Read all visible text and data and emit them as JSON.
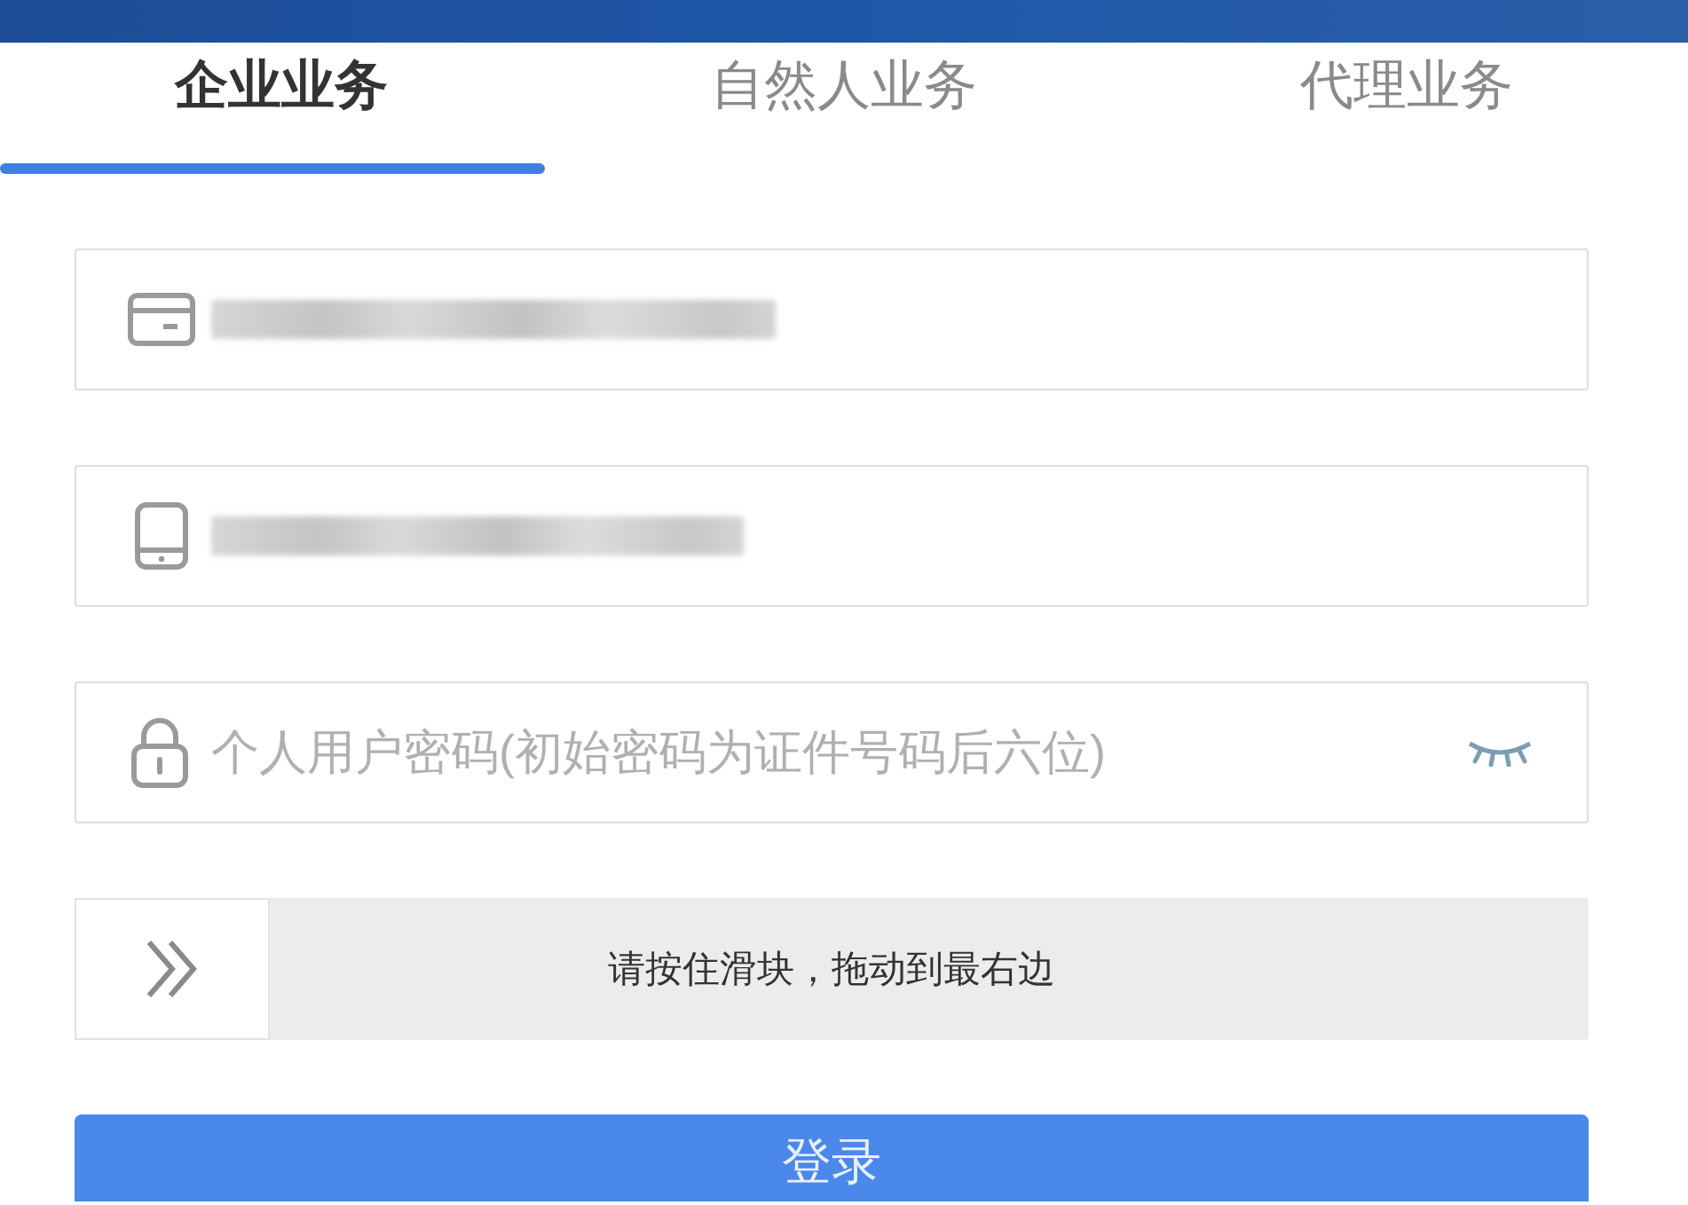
{
  "tabs": [
    {
      "label": "企业业务",
      "selected": true
    },
    {
      "label": "自然人业务",
      "selected": false
    },
    {
      "label": "代理业务",
      "selected": false
    }
  ],
  "fields": [
    {
      "kind": "id-card",
      "value_redacted": true
    },
    {
      "kind": "phone",
      "value_redacted": true
    },
    {
      "kind": "password",
      "placeholder": "个人用户密码(初始密码为证件号码后六位)",
      "password_visible": false
    }
  ],
  "slider": {
    "hint": "请按住滑块，拖动到最右边",
    "level": 0
  },
  "login_button": {
    "label": "登录"
  }
}
